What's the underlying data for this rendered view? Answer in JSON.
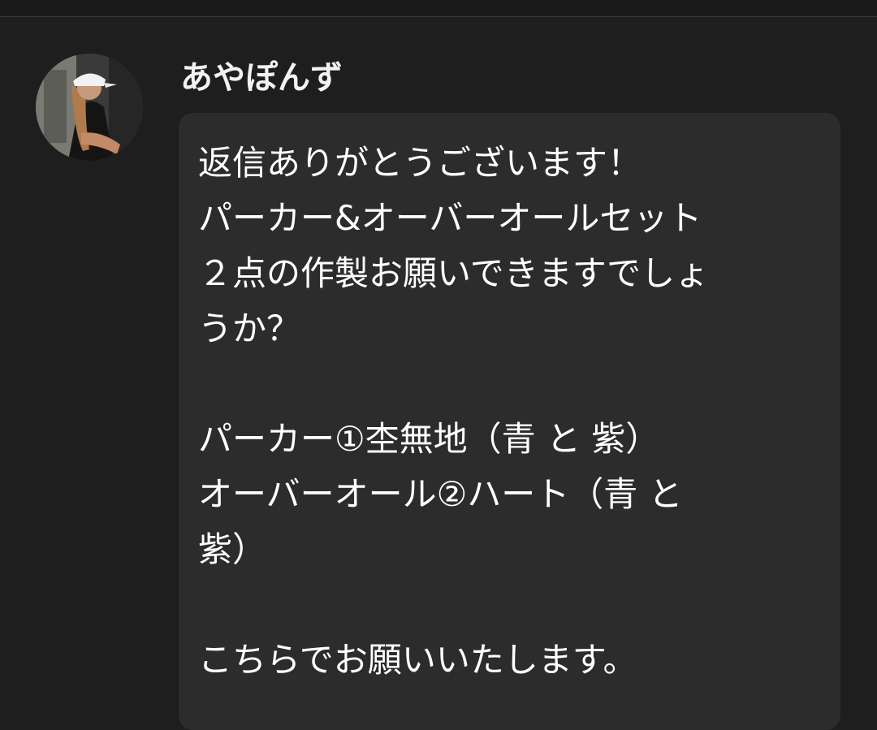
{
  "chat": {
    "sender": {
      "name": "あやぽんず",
      "avatar_icon": "user-avatar-photo"
    },
    "message": {
      "lines": [
        "返信ありがとうございます！",
        "パーカー&オーバーオールセット",
        "２点の作製お願いできますでしょ",
        "うか？",
        "",
        "パーカー①杢無地（青 と 紫）",
        "オーバーオール②ハート（青 と",
        "紫）",
        "",
        "こちらでお願いいたします。"
      ]
    }
  },
  "colors": {
    "background": "#1e1e1e",
    "bubble": "#2c2c2c",
    "text": "#ffffff"
  }
}
